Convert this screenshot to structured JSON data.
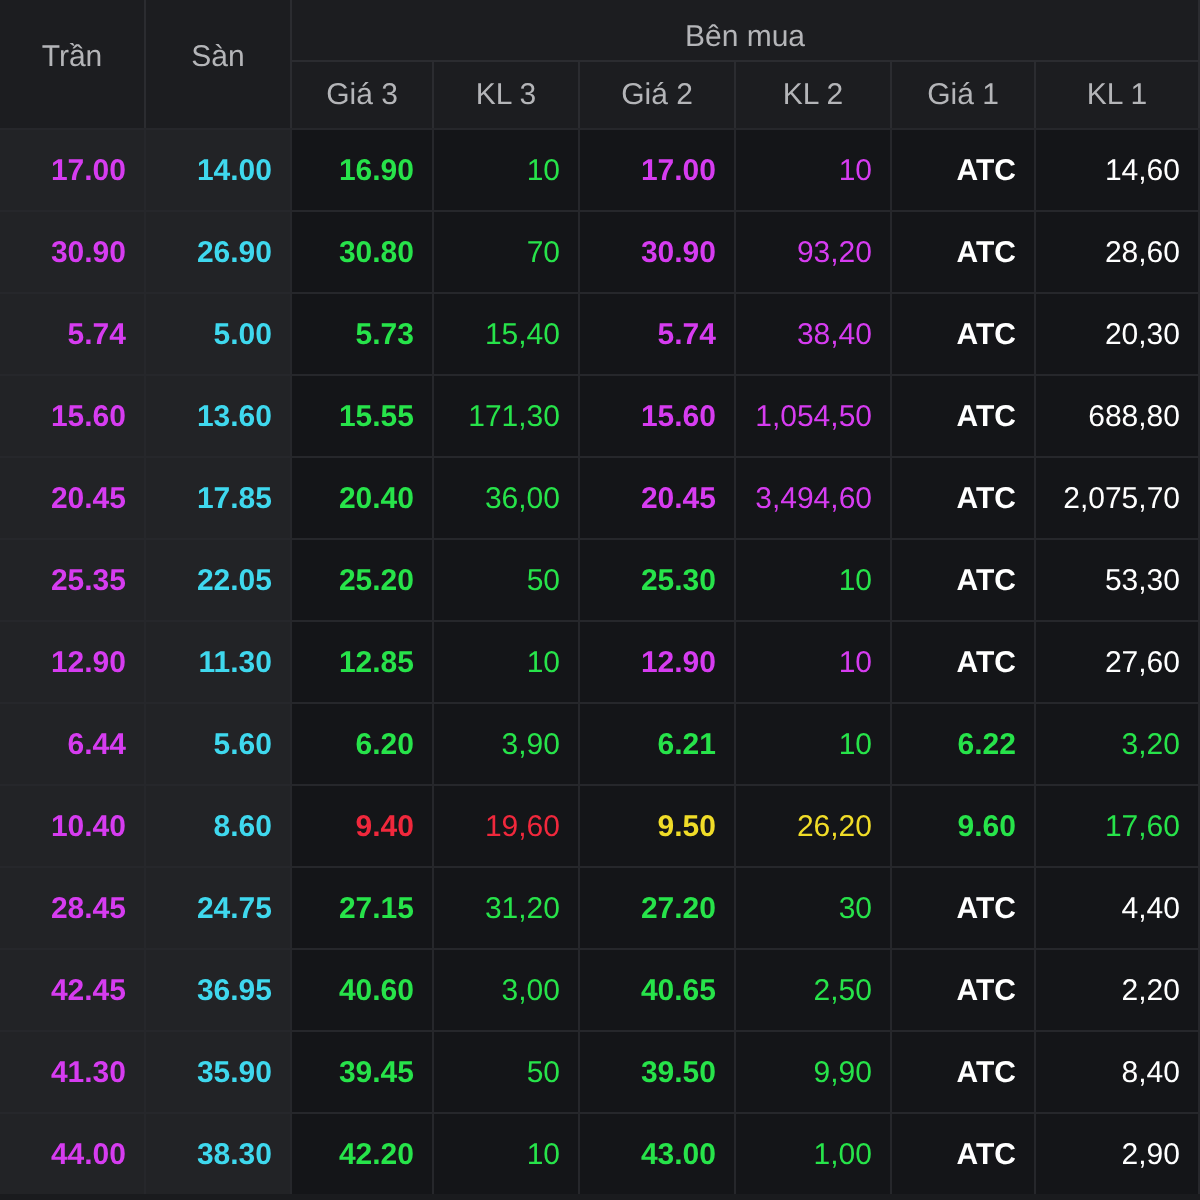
{
  "header": {
    "fixed": [
      {
        "label": "Trần",
        "kind": "price"
      },
      {
        "label": "Sàn",
        "kind": "price"
      }
    ],
    "group": {
      "label": "Bên mua",
      "columns": [
        {
          "label": "Giá 3",
          "kind": "price"
        },
        {
          "label": "KL 3",
          "kind": "volume"
        },
        {
          "label": "Giá 2",
          "kind": "price"
        },
        {
          "label": "KL 2",
          "kind": "volume"
        },
        {
          "label": "Giá 1",
          "kind": "price"
        },
        {
          "label": "KL 1",
          "kind": "volume"
        }
      ]
    }
  },
  "rows": [
    {
      "cells": [
        {
          "text": "17.00",
          "color": "#d63cf0"
        },
        {
          "text": "14.00",
          "color": "#3fd8ee"
        },
        {
          "text": "16.90",
          "color": "#27e34a"
        },
        {
          "text": "10",
          "color": "#27e34a"
        },
        {
          "text": "17.00",
          "color": "#d63cf0"
        },
        {
          "text": "10",
          "color": "#d63cf0"
        },
        {
          "text": "ATC",
          "color": "#ffffff"
        },
        {
          "text": "14,60",
          "color": "#ffffff"
        }
      ]
    },
    {
      "cells": [
        {
          "text": "30.90",
          "color": "#d63cf0"
        },
        {
          "text": "26.90",
          "color": "#3fd8ee"
        },
        {
          "text": "30.80",
          "color": "#27e34a"
        },
        {
          "text": "70",
          "color": "#27e34a"
        },
        {
          "text": "30.90",
          "color": "#d63cf0"
        },
        {
          "text": "93,20",
          "color": "#d63cf0"
        },
        {
          "text": "ATC",
          "color": "#ffffff"
        },
        {
          "text": "28,60",
          "color": "#ffffff"
        }
      ]
    },
    {
      "cells": [
        {
          "text": "5.74",
          "color": "#d63cf0"
        },
        {
          "text": "5.00",
          "color": "#3fd8ee"
        },
        {
          "text": "5.73",
          "color": "#27e34a"
        },
        {
          "text": "15,40",
          "color": "#27e34a"
        },
        {
          "text": "5.74",
          "color": "#d63cf0"
        },
        {
          "text": "38,40",
          "color": "#d63cf0"
        },
        {
          "text": "ATC",
          "color": "#ffffff"
        },
        {
          "text": "20,30",
          "color": "#ffffff"
        }
      ]
    },
    {
      "cells": [
        {
          "text": "15.60",
          "color": "#d63cf0"
        },
        {
          "text": "13.60",
          "color": "#3fd8ee"
        },
        {
          "text": "15.55",
          "color": "#27e34a"
        },
        {
          "text": "171,30",
          "color": "#27e34a"
        },
        {
          "text": "15.60",
          "color": "#d63cf0"
        },
        {
          "text": "1,054,50",
          "color": "#d63cf0"
        },
        {
          "text": "ATC",
          "color": "#ffffff"
        },
        {
          "text": "688,80",
          "color": "#ffffff"
        }
      ]
    },
    {
      "cells": [
        {
          "text": "20.45",
          "color": "#d63cf0"
        },
        {
          "text": "17.85",
          "color": "#3fd8ee"
        },
        {
          "text": "20.40",
          "color": "#27e34a"
        },
        {
          "text": "36,00",
          "color": "#27e34a"
        },
        {
          "text": "20.45",
          "color": "#d63cf0"
        },
        {
          "text": "3,494,60",
          "color": "#d63cf0"
        },
        {
          "text": "ATC",
          "color": "#ffffff"
        },
        {
          "text": "2,075,70",
          "color": "#ffffff"
        }
      ]
    },
    {
      "cells": [
        {
          "text": "25.35",
          "color": "#d63cf0"
        },
        {
          "text": "22.05",
          "color": "#3fd8ee"
        },
        {
          "text": "25.20",
          "color": "#27e34a"
        },
        {
          "text": "50",
          "color": "#27e34a"
        },
        {
          "text": "25.30",
          "color": "#27e34a"
        },
        {
          "text": "10",
          "color": "#27e34a"
        },
        {
          "text": "ATC",
          "color": "#ffffff"
        },
        {
          "text": "53,30",
          "color": "#ffffff"
        }
      ]
    },
    {
      "cells": [
        {
          "text": "12.90",
          "color": "#d63cf0"
        },
        {
          "text": "11.30",
          "color": "#3fd8ee"
        },
        {
          "text": "12.85",
          "color": "#27e34a"
        },
        {
          "text": "10",
          "color": "#27e34a"
        },
        {
          "text": "12.90",
          "color": "#d63cf0"
        },
        {
          "text": "10",
          "color": "#d63cf0"
        },
        {
          "text": "ATC",
          "color": "#ffffff"
        },
        {
          "text": "27,60",
          "color": "#ffffff"
        }
      ]
    },
    {
      "cells": [
        {
          "text": "6.44",
          "color": "#d63cf0"
        },
        {
          "text": "5.60",
          "color": "#3fd8ee"
        },
        {
          "text": "6.20",
          "color": "#27e34a"
        },
        {
          "text": "3,90",
          "color": "#27e34a"
        },
        {
          "text": "6.21",
          "color": "#27e34a"
        },
        {
          "text": "10",
          "color": "#27e34a"
        },
        {
          "text": "6.22",
          "color": "#27e34a"
        },
        {
          "text": "3,20",
          "color": "#27e34a"
        }
      ]
    },
    {
      "cells": [
        {
          "text": "10.40",
          "color": "#d63cf0"
        },
        {
          "text": "8.60",
          "color": "#3fd8ee"
        },
        {
          "text": "9.40",
          "color": "#f0283c"
        },
        {
          "text": "19,60",
          "color": "#f0283c"
        },
        {
          "text": "9.50",
          "color": "#f0dc28"
        },
        {
          "text": "26,20",
          "color": "#f0dc28"
        },
        {
          "text": "9.60",
          "color": "#27e34a"
        },
        {
          "text": "17,60",
          "color": "#27e34a"
        }
      ]
    },
    {
      "cells": [
        {
          "text": "28.45",
          "color": "#d63cf0"
        },
        {
          "text": "24.75",
          "color": "#3fd8ee"
        },
        {
          "text": "27.15",
          "color": "#27e34a"
        },
        {
          "text": "31,20",
          "color": "#27e34a"
        },
        {
          "text": "27.20",
          "color": "#27e34a"
        },
        {
          "text": "30",
          "color": "#27e34a"
        },
        {
          "text": "ATC",
          "color": "#ffffff"
        },
        {
          "text": "4,40",
          "color": "#ffffff"
        }
      ]
    },
    {
      "cells": [
        {
          "text": "42.45",
          "color": "#d63cf0"
        },
        {
          "text": "36.95",
          "color": "#3fd8ee"
        },
        {
          "text": "40.60",
          "color": "#27e34a"
        },
        {
          "text": "3,00",
          "color": "#27e34a"
        },
        {
          "text": "40.65",
          "color": "#27e34a"
        },
        {
          "text": "2,50",
          "color": "#27e34a"
        },
        {
          "text": "ATC",
          "color": "#ffffff"
        },
        {
          "text": "2,20",
          "color": "#ffffff"
        }
      ]
    },
    {
      "cells": [
        {
          "text": "41.30",
          "color": "#d63cf0"
        },
        {
          "text": "35.90",
          "color": "#3fd8ee"
        },
        {
          "text": "39.45",
          "color": "#27e34a"
        },
        {
          "text": "50",
          "color": "#27e34a"
        },
        {
          "text": "39.50",
          "color": "#27e34a"
        },
        {
          "text": "9,90",
          "color": "#27e34a"
        },
        {
          "text": "ATC",
          "color": "#ffffff"
        },
        {
          "text": "8,40",
          "color": "#ffffff"
        }
      ]
    },
    {
      "cells": [
        {
          "text": "44.00",
          "color": "#d63cf0"
        },
        {
          "text": "38.30",
          "color": "#3fd8ee"
        },
        {
          "text": "42.20",
          "color": "#27e34a"
        },
        {
          "text": "10",
          "color": "#27e34a"
        },
        {
          "text": "43.00",
          "color": "#27e34a"
        },
        {
          "text": "1,00",
          "color": "#27e34a"
        },
        {
          "text": "ATC",
          "color": "#ffffff"
        },
        {
          "text": "2,90",
          "color": "#ffffff"
        }
      ]
    }
  ]
}
